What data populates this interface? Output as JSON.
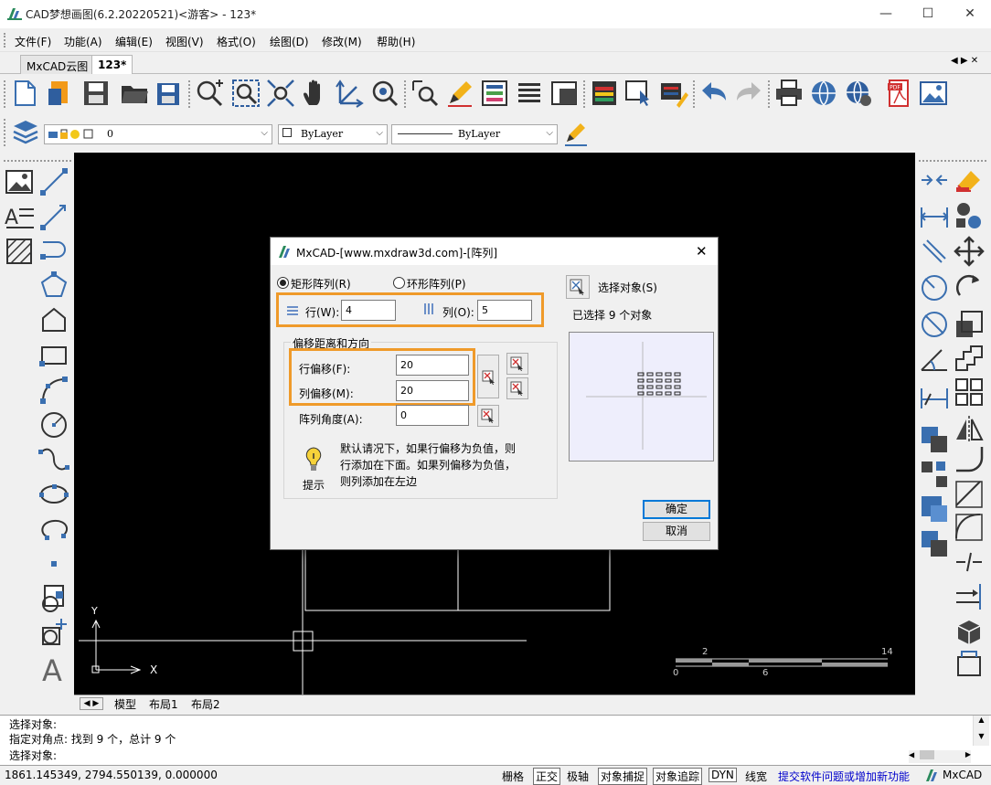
{
  "window": {
    "title": "CAD梦想画图(6.2.20220521)<游客> - 123*",
    "minimize": "—",
    "maximize": "☐",
    "close": "✕"
  },
  "menu": [
    "文件(F)",
    "功能(A)",
    "编辑(E)",
    "视图(V)",
    "格式(O)",
    "绘图(D)",
    "修改(M)",
    "帮助(H)"
  ],
  "tabs": [
    {
      "label": "MxCAD云图",
      "active": false
    },
    {
      "label": "123*",
      "active": true
    }
  ],
  "tab_nav": "◀ ▶ ✕",
  "layer_toolbar": {
    "layer_value": "0",
    "color_value": "ByLayer",
    "linetype_value": "ByLayer"
  },
  "dialog": {
    "title": "MxCAD-[www.mxdraw3d.com]-[阵列]",
    "rect_array_label": "矩形阵列(R)",
    "polar_array_label": "环形阵列(P)",
    "rows_label": "行(W):",
    "rows_value": "4",
    "cols_label": "列(O):",
    "cols_value": "5",
    "offset_group_label": "偏移距离和方向",
    "row_offset_label": "行偏移(F):",
    "row_offset_value": "20",
    "col_offset_label": "列偏移(M):",
    "col_offset_value": "20",
    "angle_label": "阵列角度(A):",
    "angle_value": "0",
    "hint_title": "提示",
    "hint_text_1": "默认请况下，如果行偏移为负值，则",
    "hint_text_2": "行添加在下面。如果列偏移为负值，",
    "hint_text_3": "则列添加在左边",
    "select_objects_label": "选择对象(S)",
    "selected_count_text": "已选择 9 个对象",
    "ok_label": "确定",
    "cancel_label": "取消",
    "preview_rows": 4,
    "preview_cols": 5
  },
  "scale_bar": {
    "top_labels": [
      "2",
      "14"
    ],
    "bottom_labels": [
      "0",
      "6"
    ]
  },
  "axes": {
    "y_label": "Y",
    "x_label": "X"
  },
  "layout_tabs": [
    "模型",
    "布局1",
    "布局2"
  ],
  "command_lines": [
    "选择对象:",
    "指定对角点:  找到 9 个，总计 9 个",
    "选择对象:"
  ],
  "status": {
    "coords": "1861.145349,  2794.550139,  0.000000",
    "items": [
      "栅格",
      "正交",
      "极轴",
      "对象捕捉",
      "对象追踪",
      "DYN",
      "线宽"
    ],
    "boxed": [
      "正交",
      "对象捕捉",
      "对象追踪",
      "DYN"
    ],
    "feedback_link": "提交软件问题或增加新功能",
    "brand": "MxCAD"
  },
  "colors": {
    "highlight": "#ef9a2a",
    "link": "#0000cc",
    "accent": "#0078d7"
  }
}
